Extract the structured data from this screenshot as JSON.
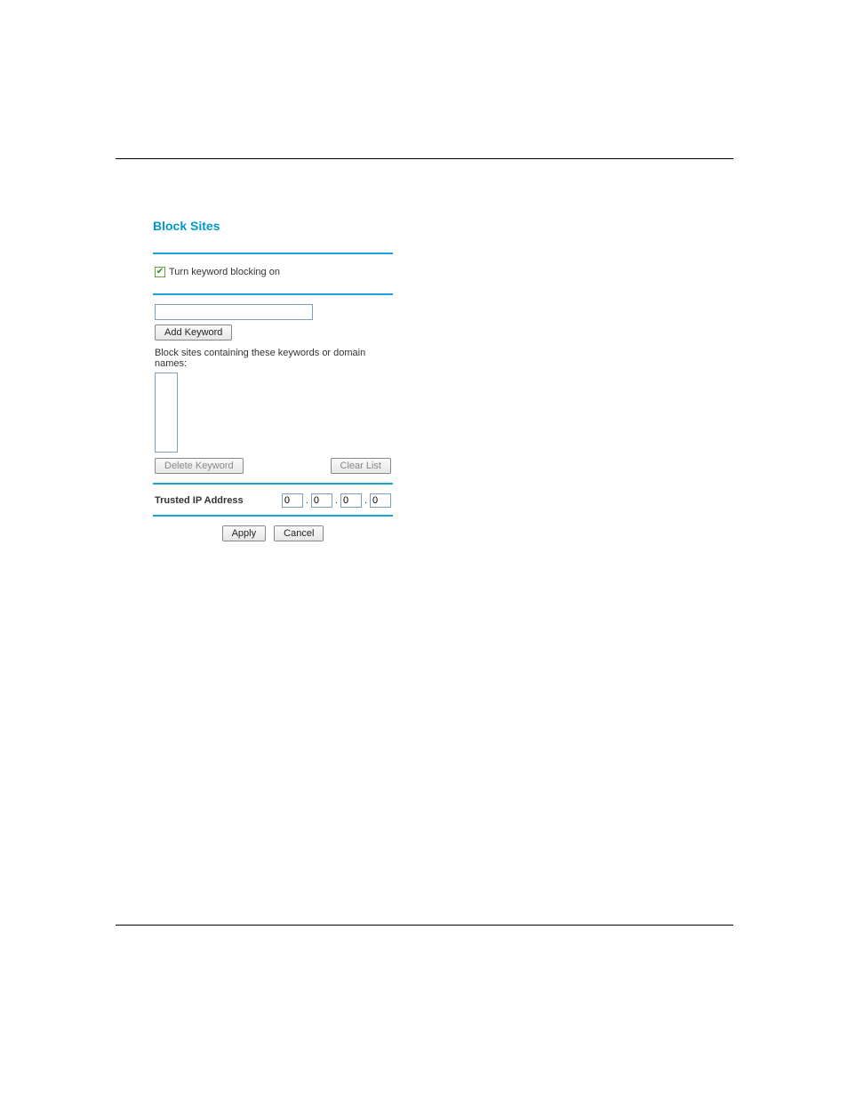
{
  "panel": {
    "title": "Block Sites",
    "checkbox": {
      "checked": true,
      "label": "Turn keyword blocking on"
    },
    "keyword_input_value": "",
    "add_keyword_label": "Add Keyword",
    "blocklist_label": "Block sites containing these keywords or domain names:",
    "delete_keyword_label": "Delete Keyword",
    "clear_list_label": "Clear List",
    "trusted_ip": {
      "label": "Trusted IP Address",
      "octets": [
        "0",
        "0",
        "0",
        "0"
      ]
    },
    "apply_label": "Apply",
    "cancel_label": "Cancel"
  }
}
